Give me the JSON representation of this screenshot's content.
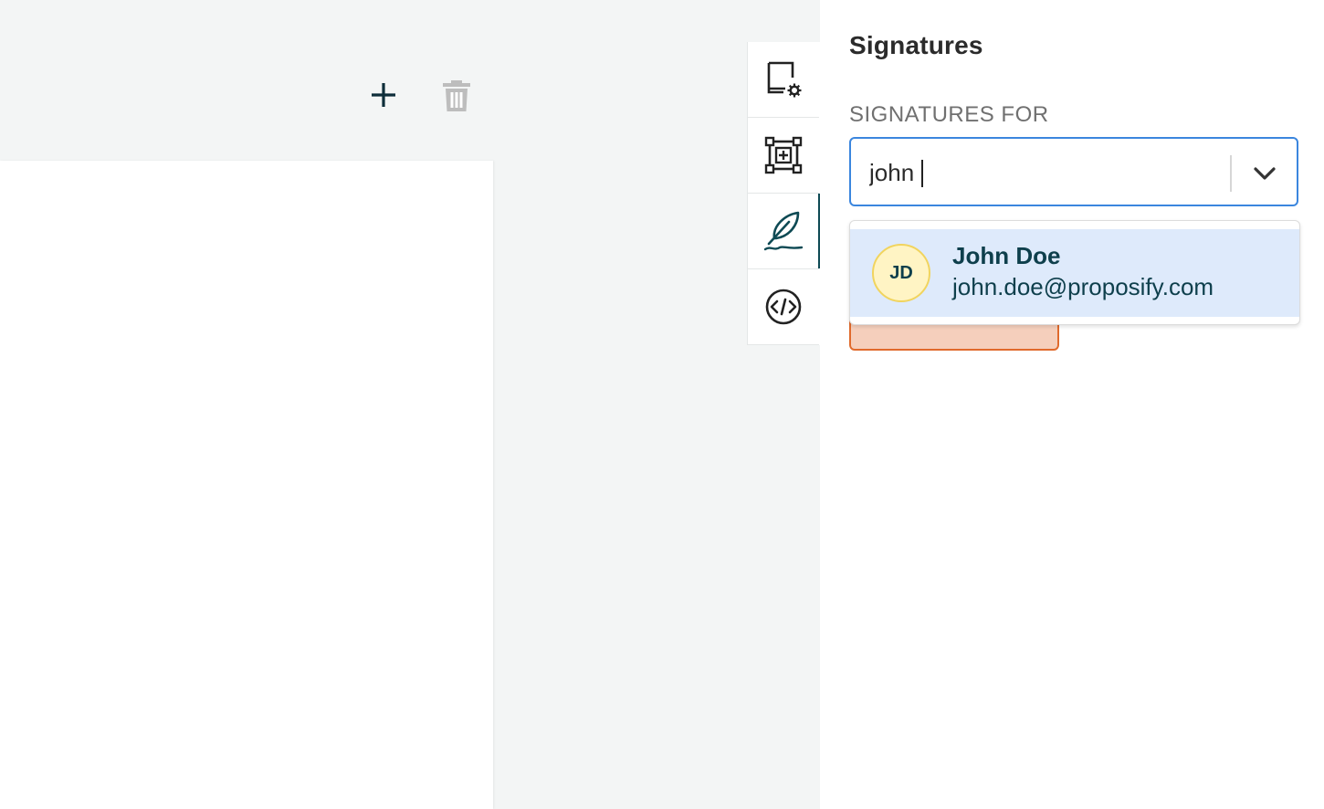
{
  "canvas": {
    "toolbar": {
      "add_icon": "plus-icon",
      "delete_icon": "trash-icon"
    }
  },
  "rail": {
    "items": [
      {
        "name": "page-settings",
        "icon": "page-settings-icon",
        "active": false
      },
      {
        "name": "add-block",
        "icon": "add-block-icon",
        "active": false
      },
      {
        "name": "signatures",
        "icon": "feather-pen-icon",
        "active": true
      },
      {
        "name": "code",
        "icon": "code-icon",
        "active": false
      }
    ],
    "active_color": "#0e4a54"
  },
  "panel": {
    "title": "Signatures",
    "section_label": "SIGNATURES FOR",
    "select": {
      "value": "john",
      "border_color": "#3b86de"
    },
    "dropdown": {
      "options": [
        {
          "initials": "JD",
          "name": "John Doe",
          "email": "john.doe@proposify.com",
          "highlighted": true
        }
      ]
    }
  }
}
